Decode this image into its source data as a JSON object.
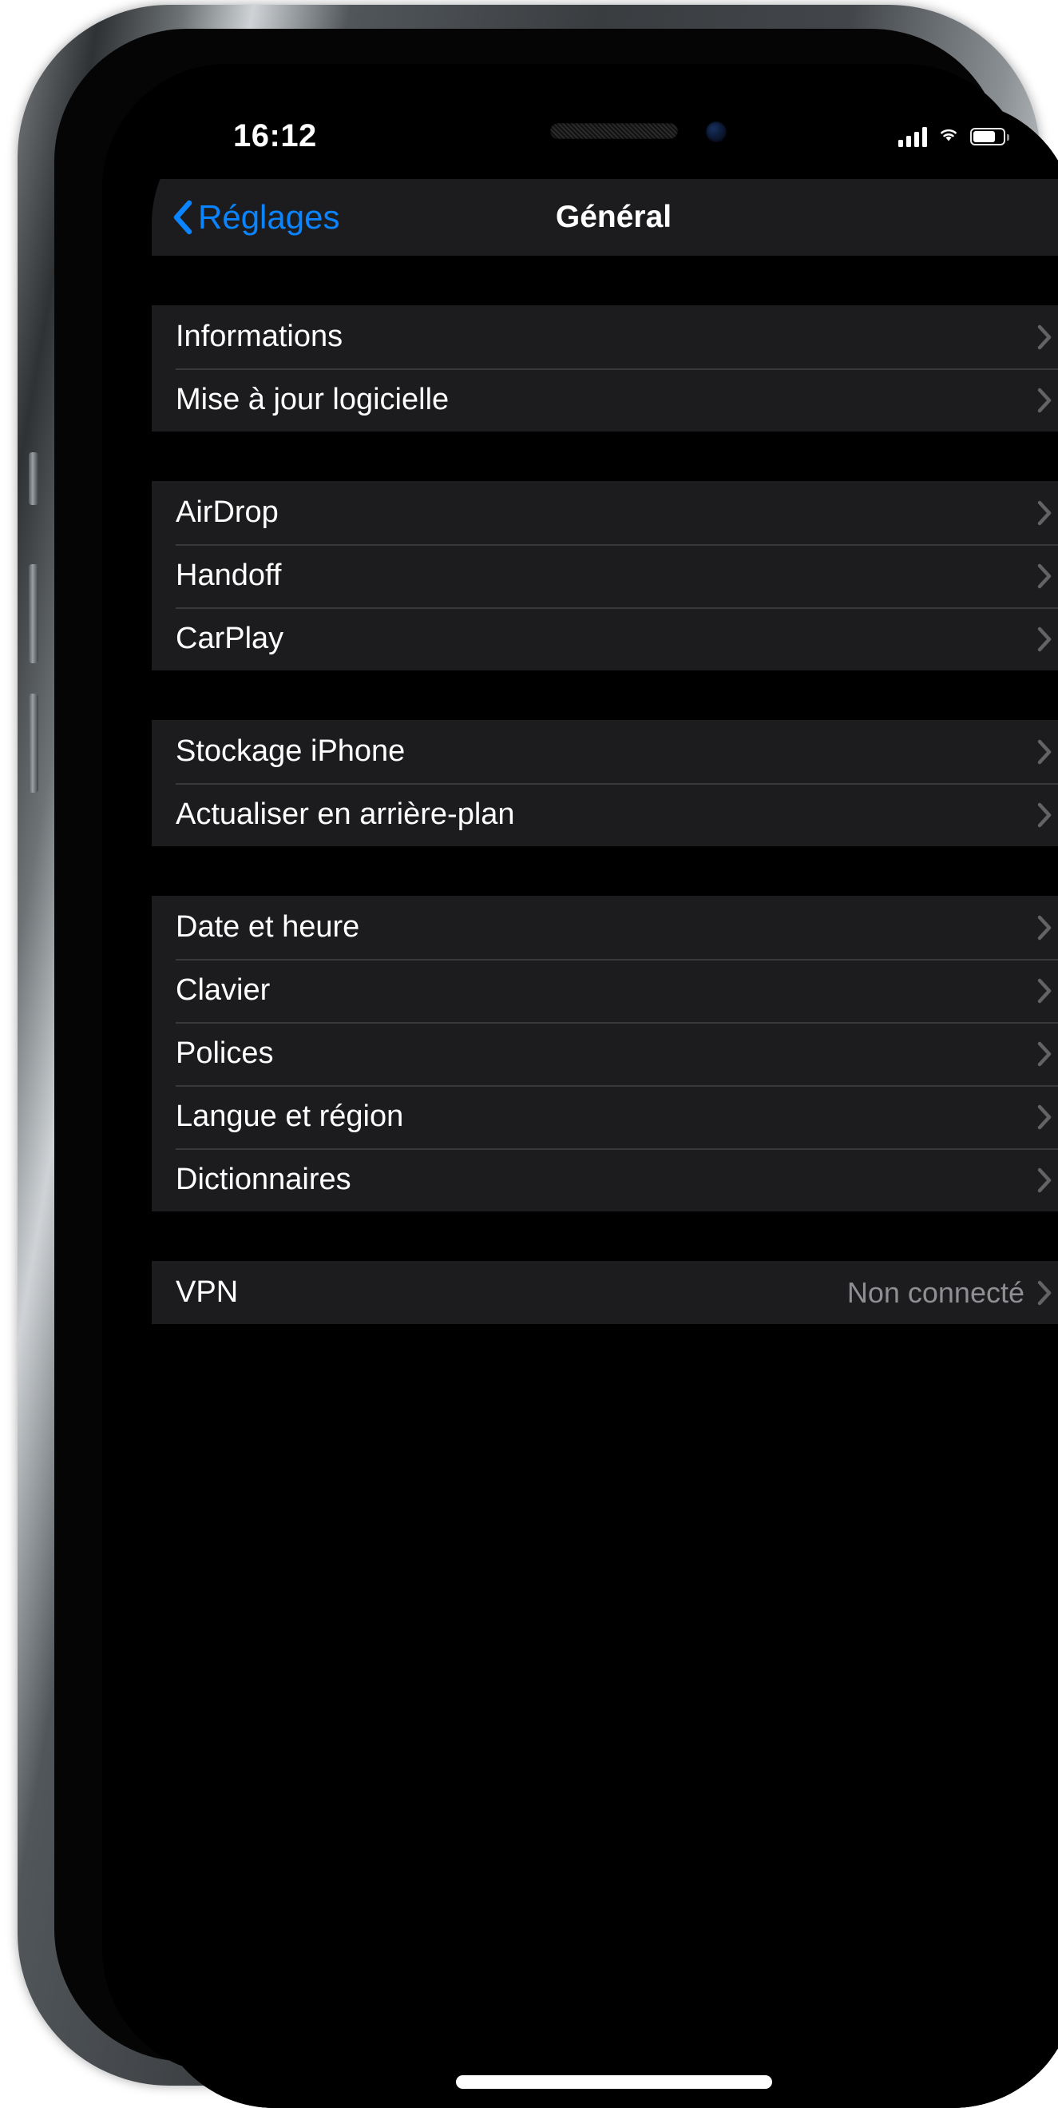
{
  "status_bar": {
    "time": "16:12",
    "icons": [
      "cellular-signal-icon",
      "wifi-icon",
      "battery-icon"
    ],
    "battery_level_percent": 68
  },
  "nav_bar": {
    "back_label": "Réglages",
    "back_icon": "chevron-left-icon",
    "title": "Général"
  },
  "colors": {
    "accent": "#0a84ff",
    "cell_background": "#1c1c1e",
    "page_background": "#000000",
    "separator": "#39393c",
    "secondary_text": "#8e8e93",
    "primary_text": "#ffffff"
  },
  "sections": [
    {
      "id": "about-section",
      "rows": [
        {
          "label": "Informations",
          "value": "",
          "accessory": "chevron-right-icon"
        },
        {
          "label": "Mise à jour logicielle",
          "value": "",
          "accessory": "chevron-right-icon"
        }
      ]
    },
    {
      "id": "continuity-section",
      "rows": [
        {
          "label": "AirDrop",
          "value": "",
          "accessory": "chevron-right-icon"
        },
        {
          "label": "Handoff",
          "value": "",
          "accessory": "chevron-right-icon"
        },
        {
          "label": "CarPlay",
          "value": "",
          "accessory": "chevron-right-icon"
        }
      ]
    },
    {
      "id": "storage-section",
      "rows": [
        {
          "label": "Stockage iPhone",
          "value": "",
          "accessory": "chevron-right-icon"
        },
        {
          "label": "Actualiser en arrière-plan",
          "value": "",
          "accessory": "chevron-right-icon"
        }
      ]
    },
    {
      "id": "localization-section",
      "rows": [
        {
          "label": "Date et heure",
          "value": "",
          "accessory": "chevron-right-icon"
        },
        {
          "label": "Clavier",
          "value": "",
          "accessory": "chevron-right-icon"
        },
        {
          "label": "Polices",
          "value": "",
          "accessory": "chevron-right-icon"
        },
        {
          "label": "Langue et région",
          "value": "",
          "accessory": "chevron-right-icon"
        },
        {
          "label": "Dictionnaires",
          "value": "",
          "accessory": "chevron-right-icon"
        }
      ]
    },
    {
      "id": "vpn-section",
      "rows": [
        {
          "label": "VPN",
          "value": "Non connecté",
          "accessory": "chevron-right-icon"
        }
      ]
    }
  ]
}
